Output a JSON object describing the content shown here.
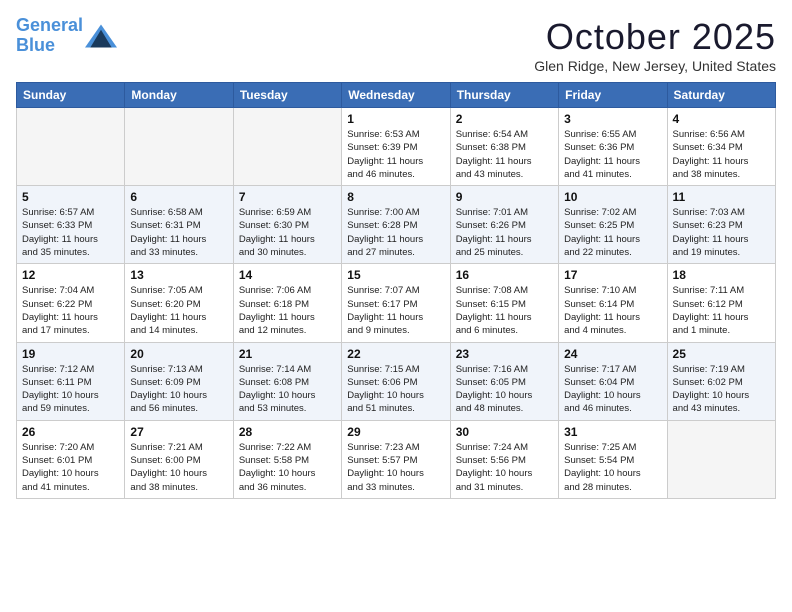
{
  "logo": {
    "line1": "General",
    "line2": "Blue"
  },
  "title": "October 2025",
  "subtitle": "Glen Ridge, New Jersey, United States",
  "days_of_week": [
    "Sunday",
    "Monday",
    "Tuesday",
    "Wednesday",
    "Thursday",
    "Friday",
    "Saturday"
  ],
  "weeks": [
    [
      {
        "day": "",
        "info": ""
      },
      {
        "day": "",
        "info": ""
      },
      {
        "day": "",
        "info": ""
      },
      {
        "day": "1",
        "info": "Sunrise: 6:53 AM\nSunset: 6:39 PM\nDaylight: 11 hours\nand 46 minutes."
      },
      {
        "day": "2",
        "info": "Sunrise: 6:54 AM\nSunset: 6:38 PM\nDaylight: 11 hours\nand 43 minutes."
      },
      {
        "day": "3",
        "info": "Sunrise: 6:55 AM\nSunset: 6:36 PM\nDaylight: 11 hours\nand 41 minutes."
      },
      {
        "day": "4",
        "info": "Sunrise: 6:56 AM\nSunset: 6:34 PM\nDaylight: 11 hours\nand 38 minutes."
      }
    ],
    [
      {
        "day": "5",
        "info": "Sunrise: 6:57 AM\nSunset: 6:33 PM\nDaylight: 11 hours\nand 35 minutes."
      },
      {
        "day": "6",
        "info": "Sunrise: 6:58 AM\nSunset: 6:31 PM\nDaylight: 11 hours\nand 33 minutes."
      },
      {
        "day": "7",
        "info": "Sunrise: 6:59 AM\nSunset: 6:30 PM\nDaylight: 11 hours\nand 30 minutes."
      },
      {
        "day": "8",
        "info": "Sunrise: 7:00 AM\nSunset: 6:28 PM\nDaylight: 11 hours\nand 27 minutes."
      },
      {
        "day": "9",
        "info": "Sunrise: 7:01 AM\nSunset: 6:26 PM\nDaylight: 11 hours\nand 25 minutes."
      },
      {
        "day": "10",
        "info": "Sunrise: 7:02 AM\nSunset: 6:25 PM\nDaylight: 11 hours\nand 22 minutes."
      },
      {
        "day": "11",
        "info": "Sunrise: 7:03 AM\nSunset: 6:23 PM\nDaylight: 11 hours\nand 19 minutes."
      }
    ],
    [
      {
        "day": "12",
        "info": "Sunrise: 7:04 AM\nSunset: 6:22 PM\nDaylight: 11 hours\nand 17 minutes."
      },
      {
        "day": "13",
        "info": "Sunrise: 7:05 AM\nSunset: 6:20 PM\nDaylight: 11 hours\nand 14 minutes."
      },
      {
        "day": "14",
        "info": "Sunrise: 7:06 AM\nSunset: 6:18 PM\nDaylight: 11 hours\nand 12 minutes."
      },
      {
        "day": "15",
        "info": "Sunrise: 7:07 AM\nSunset: 6:17 PM\nDaylight: 11 hours\nand 9 minutes."
      },
      {
        "day": "16",
        "info": "Sunrise: 7:08 AM\nSunset: 6:15 PM\nDaylight: 11 hours\nand 6 minutes."
      },
      {
        "day": "17",
        "info": "Sunrise: 7:10 AM\nSunset: 6:14 PM\nDaylight: 11 hours\nand 4 minutes."
      },
      {
        "day": "18",
        "info": "Sunrise: 7:11 AM\nSunset: 6:12 PM\nDaylight: 11 hours\nand 1 minute."
      }
    ],
    [
      {
        "day": "19",
        "info": "Sunrise: 7:12 AM\nSunset: 6:11 PM\nDaylight: 10 hours\nand 59 minutes."
      },
      {
        "day": "20",
        "info": "Sunrise: 7:13 AM\nSunset: 6:09 PM\nDaylight: 10 hours\nand 56 minutes."
      },
      {
        "day": "21",
        "info": "Sunrise: 7:14 AM\nSunset: 6:08 PM\nDaylight: 10 hours\nand 53 minutes."
      },
      {
        "day": "22",
        "info": "Sunrise: 7:15 AM\nSunset: 6:06 PM\nDaylight: 10 hours\nand 51 minutes."
      },
      {
        "day": "23",
        "info": "Sunrise: 7:16 AM\nSunset: 6:05 PM\nDaylight: 10 hours\nand 48 minutes."
      },
      {
        "day": "24",
        "info": "Sunrise: 7:17 AM\nSunset: 6:04 PM\nDaylight: 10 hours\nand 46 minutes."
      },
      {
        "day": "25",
        "info": "Sunrise: 7:19 AM\nSunset: 6:02 PM\nDaylight: 10 hours\nand 43 minutes."
      }
    ],
    [
      {
        "day": "26",
        "info": "Sunrise: 7:20 AM\nSunset: 6:01 PM\nDaylight: 10 hours\nand 41 minutes."
      },
      {
        "day": "27",
        "info": "Sunrise: 7:21 AM\nSunset: 6:00 PM\nDaylight: 10 hours\nand 38 minutes."
      },
      {
        "day": "28",
        "info": "Sunrise: 7:22 AM\nSunset: 5:58 PM\nDaylight: 10 hours\nand 36 minutes."
      },
      {
        "day": "29",
        "info": "Sunrise: 7:23 AM\nSunset: 5:57 PM\nDaylight: 10 hours\nand 33 minutes."
      },
      {
        "day": "30",
        "info": "Sunrise: 7:24 AM\nSunset: 5:56 PM\nDaylight: 10 hours\nand 31 minutes."
      },
      {
        "day": "31",
        "info": "Sunrise: 7:25 AM\nSunset: 5:54 PM\nDaylight: 10 hours\nand 28 minutes."
      },
      {
        "day": "",
        "info": ""
      }
    ]
  ]
}
